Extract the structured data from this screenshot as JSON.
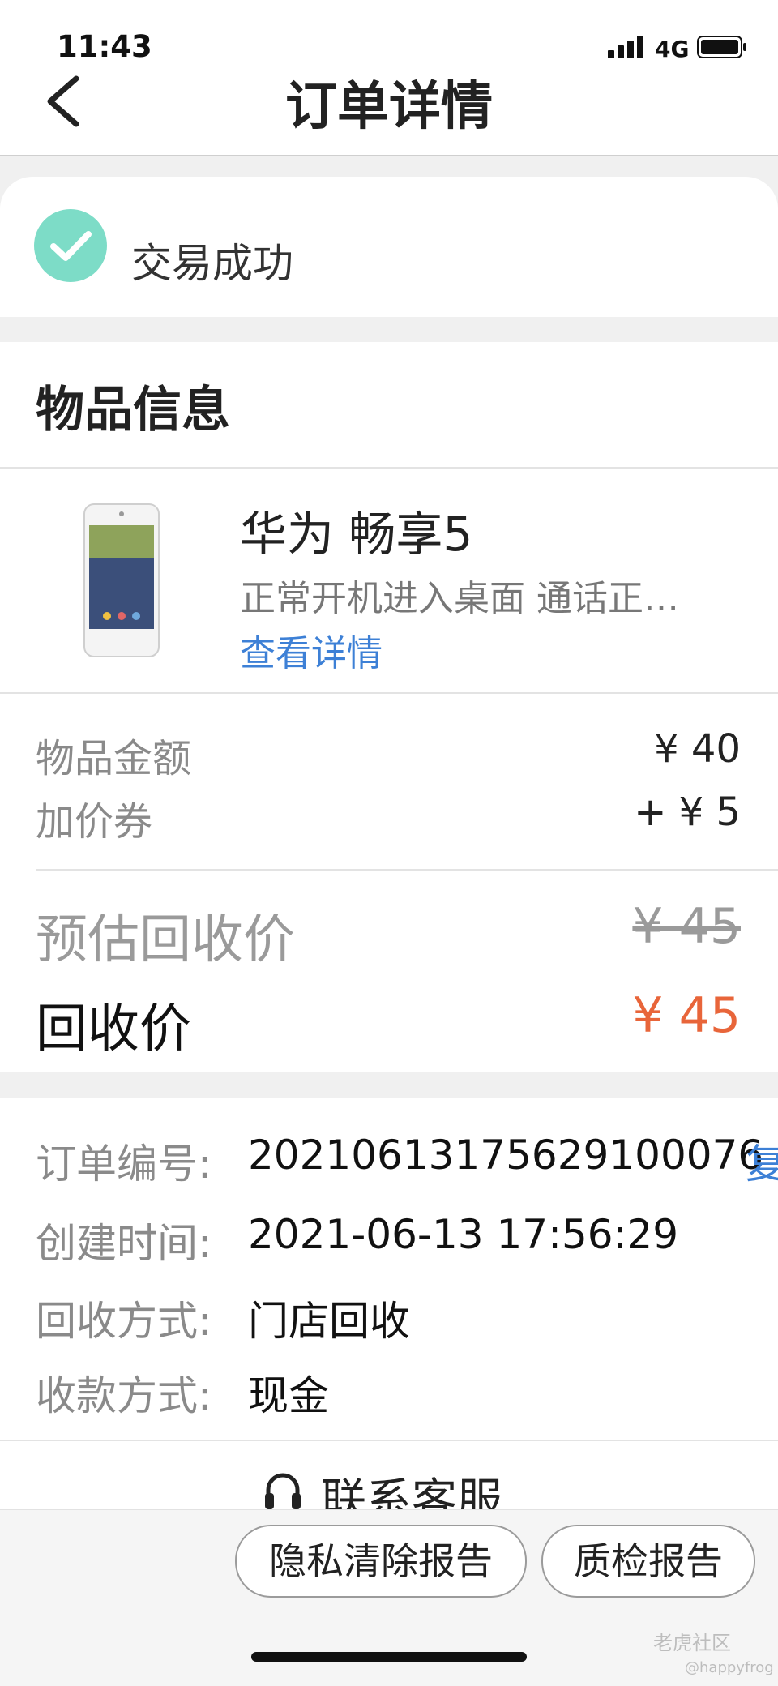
{
  "status_bar": {
    "time": "11:43",
    "network": "4G"
  },
  "nav": {
    "title": "订单详情"
  },
  "order_status": {
    "text": "交易成功",
    "colors": {
      "check": "#7ddcc7"
    }
  },
  "goods": {
    "section_title": "物品信息",
    "name": "华为 畅享5",
    "description": "正常开机进入桌面 通话正…",
    "detail_link": "查看详情",
    "amount_label": "物品金额",
    "amount_value": "¥ 40",
    "coupon_label": "加价券",
    "coupon_value": "+ ¥ 5",
    "estimated_label": "预估回收价",
    "estimated_value": "¥ 45",
    "final_label": "回收价",
    "final_value": "¥ 45",
    "colors": {
      "link": "#3d80d6",
      "final_price": "#e8653a"
    }
  },
  "order_info": {
    "order_no_label": "订单编号:",
    "order_no_value": "20210613175629100076",
    "copy_label": "复",
    "created_label": "创建时间:",
    "created_value": "2021-06-13 17:56:29",
    "method_label": "回收方式:",
    "method_value": "门店回收",
    "payment_label": "收款方式:",
    "payment_value": "现金"
  },
  "customer_service": {
    "label": "联系客服",
    "icon": "headset-icon"
  },
  "actions": {
    "privacy_report": "隐私清除报告",
    "quality_report": "质检报告"
  },
  "watermark": {
    "line1": "老虎社区",
    "line2": "@happyfrog"
  }
}
